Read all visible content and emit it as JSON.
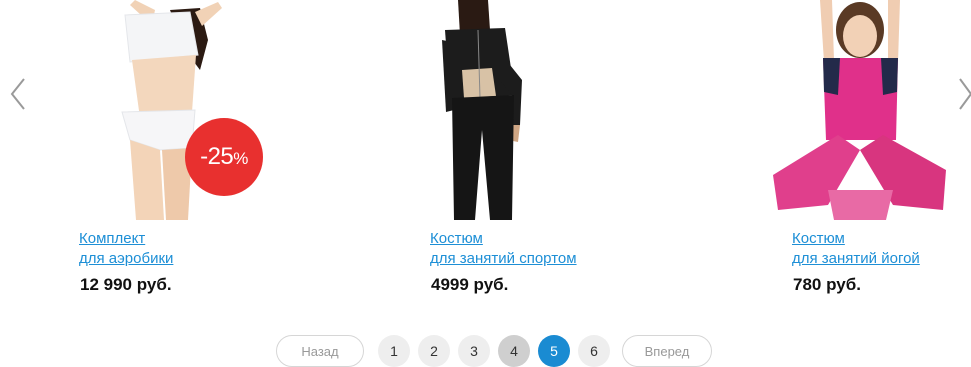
{
  "colors": {
    "link": "#1d8fd6",
    "badge": "#e8302f",
    "active_page": "#1a8bd2",
    "page_bg": "#eeeeee",
    "page_visited": "#cfcfcf"
  },
  "carousel": {
    "prev_icon": "chevron-left-icon",
    "next_icon": "chevron-right-icon",
    "products": [
      {
        "title_line1": "Комплект",
        "title_line2": "для аэробики",
        "price": "12 990 руб.",
        "discount": "-25",
        "discount_unit": "%"
      },
      {
        "title_line1": "Костюм",
        "title_line2": "для занятий спортом",
        "price": "4999 руб."
      },
      {
        "title_line1": "Костюм",
        "title_line2": "для занятий йогой",
        "price": "780 руб."
      }
    ]
  },
  "pagination": {
    "prev_label": "Назад",
    "next_label": "Вперед",
    "pages": [
      "1",
      "2",
      "3",
      "4",
      "5",
      "6"
    ],
    "current": "5",
    "visited": "4"
  }
}
